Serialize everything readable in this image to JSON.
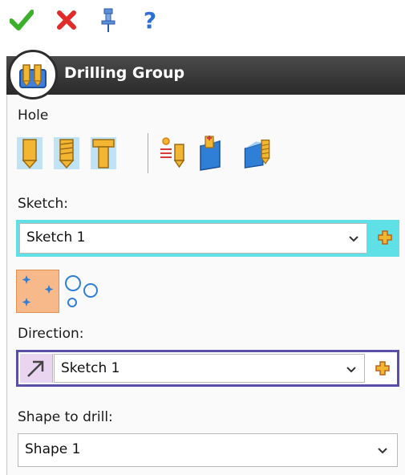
{
  "toolbar": {
    "ok_icon": "checkmark-icon",
    "cancel_icon": "close-icon",
    "pin_icon": "pin-icon",
    "help_label": "?"
  },
  "header": {
    "title": "Drilling Group",
    "icon": "drilling-group-icon"
  },
  "hole": {
    "label": "Hole",
    "tools": [
      "simple-hole-icon",
      "threaded-hole-icon",
      "counterbore-hole-icon",
      "hole-series-icon",
      "add-hole-icon",
      "hole-from-shape-icon"
    ]
  },
  "sketch": {
    "label": "Sketch:",
    "value": "Sketch 1"
  },
  "points": {
    "tools": [
      "point-pattern-icon",
      "circle-pattern-icon"
    ]
  },
  "direction": {
    "label": "Direction:",
    "value": "Sketch 1"
  },
  "shape": {
    "label": "Shape to drill:",
    "value": "Shape 1"
  },
  "colors": {
    "accent_cyan": "#5fe0e6",
    "accent_purple": "#5a4fa8",
    "plus_orange": "#e8961e",
    "header_dark": "#333333"
  }
}
